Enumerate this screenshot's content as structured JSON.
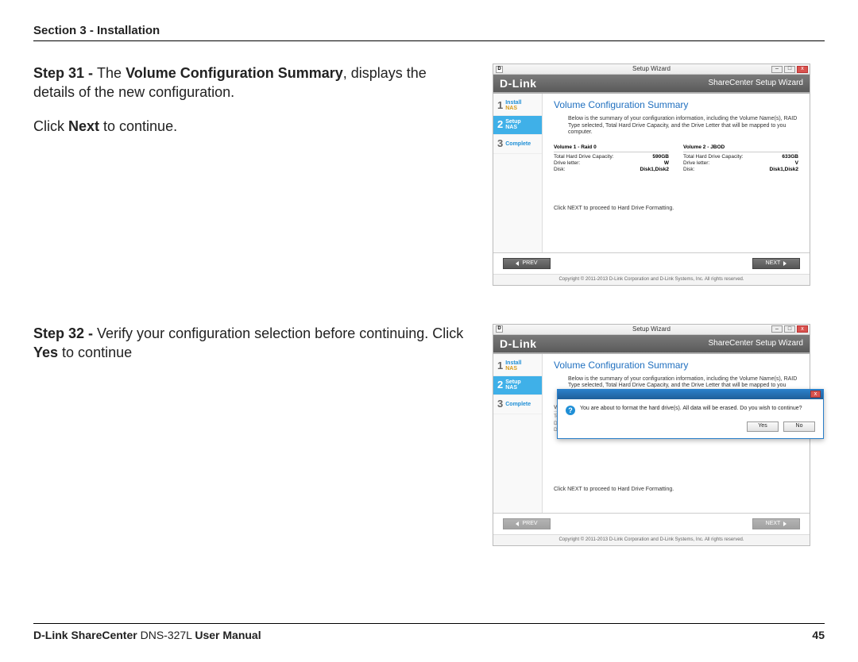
{
  "header": {
    "section": "Section 3 - Installation"
  },
  "steps": [
    {
      "label": "Step 31 - ",
      "bold1": "Volume Configuration Summary",
      "tail1": ", displays the details of the new configuration.",
      "line2a": "Click ",
      "line2b": "Next",
      "line2c": " to continue."
    },
    {
      "label": "Step 32 - ",
      "tail1": "Verify your configuration selection before continuing. Click ",
      "bold1": "Yes",
      "tail2": " to continue"
    }
  ],
  "wizard": {
    "win_title": "Setup Wizard",
    "minimize": "–",
    "maximize": "□",
    "close": "x",
    "brand": "D-Link",
    "brand_sub": "ShareCenter Setup Wizard",
    "side": [
      {
        "num": "1",
        "l1": "Install",
        "l2": "NAS"
      },
      {
        "num": "2",
        "l1": "Setup",
        "l2": "NAS"
      },
      {
        "num": "3",
        "l1": "Complete",
        "l2": ""
      }
    ],
    "title": "Volume Configuration Summary",
    "desc": "Below is the summary of your configuration information, including the Volume Name(s), RAID Type selected, Total Hard Drive Capacity, and the Drive Letter that will be mapped to you computer.",
    "vol1": {
      "name": "Volume 1 - Raid 0",
      "rows": [
        {
          "k": "Total Hard Drive Capacity:",
          "v": "590GB"
        },
        {
          "k": "Drive letter:",
          "v": "W"
        },
        {
          "k": "Disk:",
          "v": "Disk1,Disk2"
        }
      ]
    },
    "vol2": {
      "name": "Volume 2 - JBOD",
      "rows": [
        {
          "k": "Total Hard Drive Capacity:",
          "v": "633GB"
        },
        {
          "k": "Drive letter:",
          "v": "V"
        },
        {
          "k": "Disk:",
          "v": "Disk1,Disk2"
        }
      ]
    },
    "hint": "Click NEXT to proceed to Hard Drive Formatting.",
    "prev": "PREV",
    "next": "NEXT",
    "copyright": "Copyright © 2011-2013 D-Link Corporation and D-Link Systems, Inc. All rights reserved."
  },
  "modal": {
    "text": "You are about to format the hard drive(s). All data will be erased. Do you wish to continue?",
    "yes": "Yes",
    "no": "No"
  },
  "footer": {
    "product_bold": "D-Link ShareCenter ",
    "model": "DNS-327L ",
    "suffix": "User Manual",
    "page": "45"
  }
}
